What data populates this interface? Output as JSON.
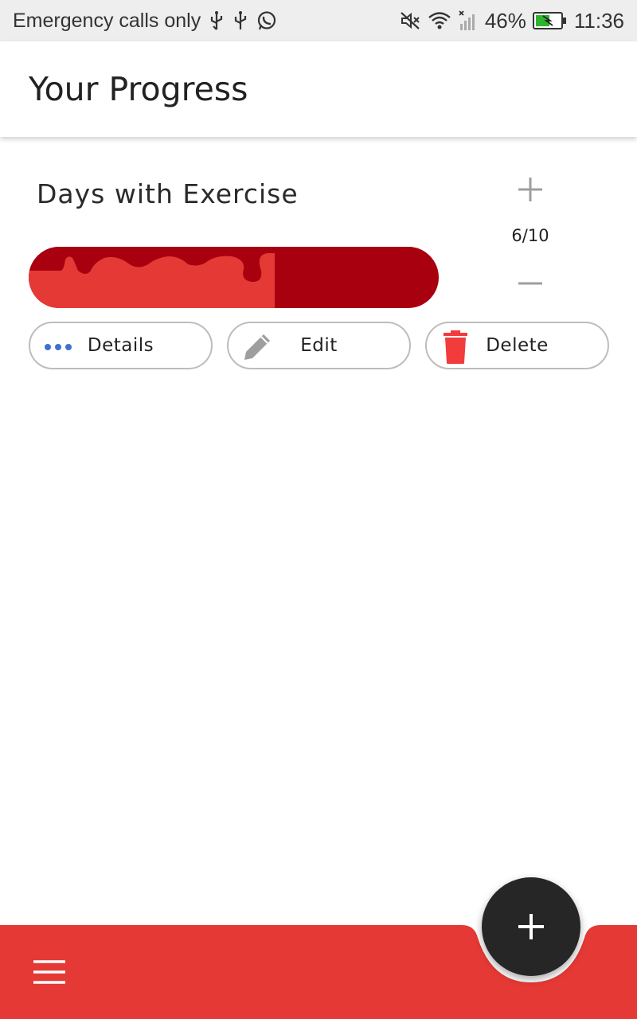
{
  "status_bar": {
    "carrier_text": "Emergency calls only",
    "left_icons": [
      "usb-icon",
      "usb-icon",
      "whatsapp-icon"
    ],
    "right_icons": [
      "mute-icon",
      "wifi-icon",
      "no-signal-icon",
      "battery-charging-icon"
    ],
    "battery_percent": "46%",
    "time": "11:36"
  },
  "app_bar": {
    "title": "Your Progress"
  },
  "goal": {
    "title": "Days with Exercise",
    "current": 6,
    "target": 10,
    "count_label": "6/10",
    "progress_fraction": 0.6,
    "increment_icon": "plus-icon",
    "decrement_icon": "minus-icon",
    "actions": {
      "details_label": "Details",
      "details_icon": "more-dots-icon",
      "edit_label": "Edit",
      "edit_icon": "pencil-icon",
      "delete_label": "Delete",
      "delete_icon": "trash-icon"
    }
  },
  "bottom_bar": {
    "menu_icon": "hamburger-menu-icon",
    "fab_icon": "plus-icon"
  },
  "colors": {
    "accent_red": "#e53935",
    "progress_track": "#a8000f",
    "fab_dark": "#262626",
    "details_icon_blue": "#3f6fd1",
    "delete_icon_red": "#f23b3b",
    "status_bar_bg": "#eeeeee"
  }
}
